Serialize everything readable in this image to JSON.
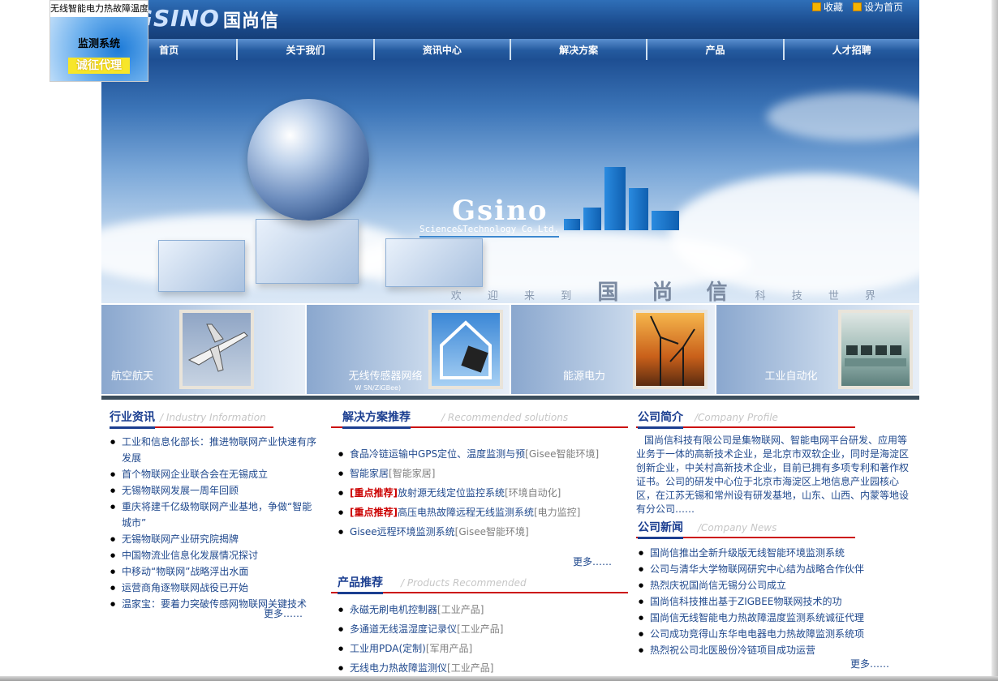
{
  "header": {
    "logo_en": "GSINO",
    "logo_cn": "国尚信",
    "fav_label": "收藏",
    "home_label": "设为首页"
  },
  "nav": [
    "首页",
    "关于我们",
    "资讯中心",
    "解决方案",
    "产品",
    "人才招聘"
  ],
  "banner": {
    "brand": "Gsino",
    "brand_sub": "Science&Technology Co.Ltd.",
    "welcome_pre": "欢 迎 来 到",
    "welcome_name": "国 尚 信",
    "welcome_post": "科 技 世 界"
  },
  "thumbs": [
    {
      "label": "航空航天",
      "sub": ""
    },
    {
      "label": "无线传感器网络",
      "sub": "W SN/ZiGBee)"
    },
    {
      "label": "能源电力",
      "sub": ""
    },
    {
      "label": "工业自动化",
      "sub": ""
    }
  ],
  "industry": {
    "title": "行业资讯",
    "en": "/ Industry Information",
    "items": [
      "工业和信息化部长：推进物联网产业快速有序发展",
      "首个物联网企业联合会在无锡成立",
      "无锡物联网发展一周年回顾",
      "重庆将建千亿级物联网产业基地，争做“智能城市”",
      "无锡物联网产业研究院揭牌",
      "中国物流业信息化发展情况探讨",
      "中移动“物联网”战略浮出水面",
      "运营商角逐物联网战役已开始",
      "温家宝：要着力突破传感网物联网关键技术"
    ],
    "more": "更多……"
  },
  "solutions": {
    "title": "解决方案推荐",
    "en": "/ Recommended solutions",
    "items": [
      {
        "hot": "",
        "text": "食品冷链运输中GPS定位、温度监测与预",
        "tag": "[Gisee智能环境]"
      },
      {
        "hot": "",
        "text": "智能家居",
        "tag": "[智能家居]"
      },
      {
        "hot": "[重点推荐]",
        "text": "放射源无线定位监控系统",
        "tag": "[环境自动化]"
      },
      {
        "hot": "[重点推荐]",
        "text": "高压电热故障远程无线监测系统",
        "tag": "[电力监控]"
      },
      {
        "hot": "",
        "text": "Gisee远程环境监测系统",
        "tag": "[Gisee智能环境]"
      }
    ],
    "more": "更多……"
  },
  "products": {
    "title": "产品推荐",
    "en": "/ Products Recommended",
    "items": [
      {
        "text": "永磁无刷电机控制器",
        "tag": "[工业产品]"
      },
      {
        "text": "多通道无线温湿度记录仪",
        "tag": "[工业产品]"
      },
      {
        "text": "工业用PDA(定制)",
        "tag": "[军用产品]"
      },
      {
        "text": "无线电力热故障监测仪",
        "tag": "[工业产品]"
      }
    ]
  },
  "profile": {
    "title": "公司简介",
    "en": "/Company Profile",
    "text": "国尚信科技有限公司是集物联网、智能电网平台研发、应用等业务于一体的高新技术企业，是北京市双软企业，同时是海淀区创新企业，中关村高新技术企业，目前已拥有多项专利和著作权证书。公司的研发中心位于北京市海淀区上地信息产业园核心区，在江苏无锡和常州设有研发基地，山东、山西、内蒙等地设有分公司……"
  },
  "news": {
    "title": "公司新闻",
    "en": "/Company News",
    "items": [
      "国尚信推出全新升级版无线智能环境监测系统",
      "公司与清华大学物联网研究中心结为战略合作伙伴",
      "热烈庆祝国尚信无锡分公司成立",
      "国尚信科技推出基于ZIGBEE物联网技术的功",
      "国尚信无线智能电力热故障温度监测系统诚征代理",
      "公司成功竞得山东华电电器电力热故障监测系统项",
      "热烈祝公司北医股份冷链项目成功运营"
    ],
    "more": "更多……"
  },
  "ad": {
    "line1": "无线智能电力热故障温度",
    "line2": "监测系统",
    "line3": "诚征代理"
  }
}
